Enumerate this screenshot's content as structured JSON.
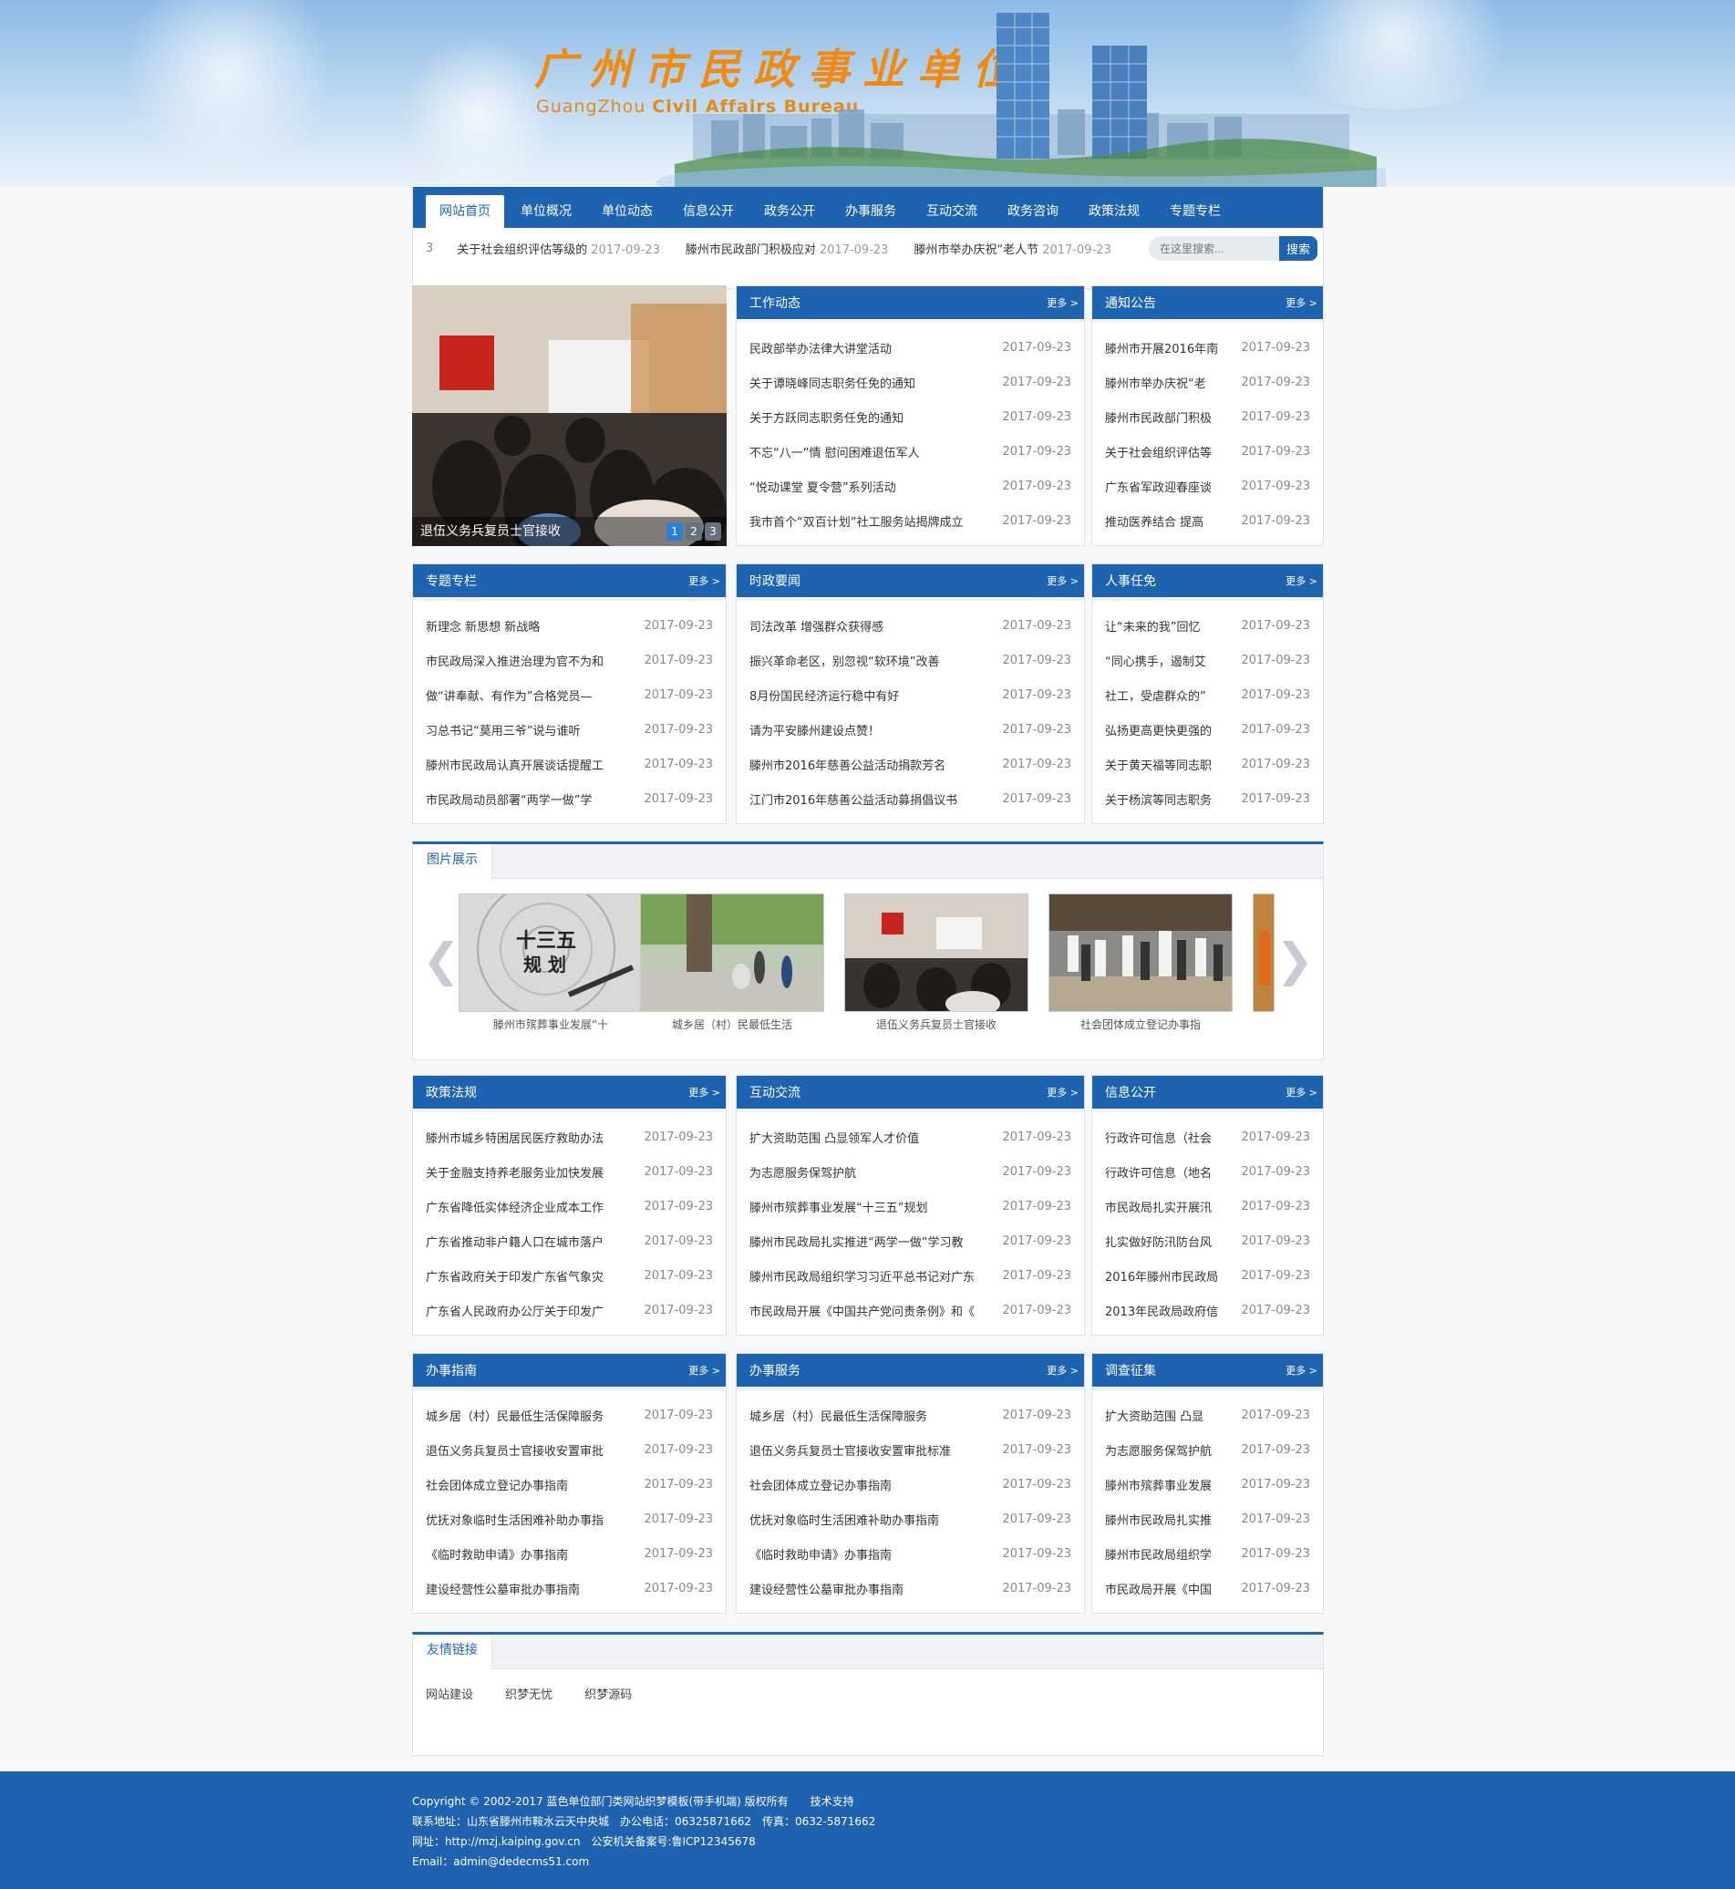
{
  "header": {
    "logo_cn": "广州市民政事业单位",
    "logo_en_light": "GuangZhou ",
    "logo_en_bold": "Civil Affairs Bureau"
  },
  "nav": [
    "网站首页",
    "单位概况",
    "单位动态",
    "信息公开",
    "政务公开",
    "办事服务",
    "互动交流",
    "政务咨询",
    "政策法规",
    "专题专栏"
  ],
  "ticker": {
    "index": "3",
    "items": [
      {
        "title": "关于社会组织评估等级的",
        "date": "2017-09-23"
      },
      {
        "title": "滕州市民政部门积极应对",
        "date": "2017-09-23"
      },
      {
        "title": "滕州市举办庆祝“老人节",
        "date": "2017-09-23"
      }
    ]
  },
  "search": {
    "placeholder": "在这里搜索...",
    "button": "搜索"
  },
  "slider": {
    "caption": "退伍义务兵复员士官接收",
    "dots": [
      "1",
      "2",
      "3"
    ]
  },
  "more": "更多 >",
  "panels": {
    "gzdt": {
      "title": "工作动态",
      "items": [
        [
          "民政部举办法律大讲堂活动",
          "2017-09-23"
        ],
        [
          "关于谭晓峰同志职务任免的通知",
          "2017-09-23"
        ],
        [
          "关于方跃同志职务任免的通知",
          "2017-09-23"
        ],
        [
          "不忘“八一”情 慰问困难退伍军人",
          "2017-09-23"
        ],
        [
          "“悦动课堂 夏令营”系列活动",
          "2017-09-23"
        ],
        [
          "我市首个“双百计划”社工服务站揭牌成立",
          "2017-09-23"
        ]
      ]
    },
    "tzgg": {
      "title": "通知公告",
      "items": [
        [
          "滕州市开展2016年南",
          "2017-09-23"
        ],
        [
          "滕州市举办庆祝“老",
          "2017-09-23"
        ],
        [
          "滕州市民政部门积极",
          "2017-09-23"
        ],
        [
          "关于社会组织评估等",
          "2017-09-23"
        ],
        [
          "广东省军政迎春座谈",
          "2017-09-23"
        ],
        [
          "推动医养结合 提高",
          "2017-09-23"
        ]
      ]
    },
    "ztzl": {
      "title": "专题专栏",
      "items": [
        [
          "新理念 新思想 新战略",
          "2017-09-23"
        ],
        [
          "市民政局深入推进治理为官不为和",
          "2017-09-23"
        ],
        [
          "做“讲奉献、有作为”合格党员—",
          "2017-09-23"
        ],
        [
          "习总书记“莫用三爷”说与谁听",
          "2017-09-23"
        ],
        [
          "滕州市民政局认真开展谈话提醒工",
          "2017-09-23"
        ],
        [
          "市民政局动员部署“两学一做”学",
          "2017-09-23"
        ]
      ]
    },
    "szyw": {
      "title": "时政要闻",
      "items": [
        [
          "司法改革 增强群众获得感",
          "2017-09-23"
        ],
        [
          "振兴革命老区，别忽视“软环境”改善",
          "2017-09-23"
        ],
        [
          "8月份国民经济运行稳中有好",
          "2017-09-23"
        ],
        [
          "请为平安滕州建设点赞！",
          "2017-09-23"
        ],
        [
          "滕州市2016年慈善公益活动捐款芳名",
          "2017-09-23"
        ],
        [
          "江门市2016年慈善公益活动募捐倡议书",
          "2017-09-23"
        ]
      ]
    },
    "rsrm": {
      "title": "人事任免",
      "items": [
        [
          "让“未来的我”回忆",
          "2017-09-23"
        ],
        [
          "“同心携手，遏制艾",
          "2017-09-23"
        ],
        [
          "社工，受虐群众的”",
          "2017-09-23"
        ],
        [
          "弘扬更高更快更强的",
          "2017-09-23"
        ],
        [
          "关于黄天福等同志职",
          "2017-09-23"
        ],
        [
          "关于杨滨等同志职务",
          "2017-09-23"
        ]
      ]
    },
    "zcfg": {
      "title": "政策法规",
      "items": [
        [
          "滕州市城乡特困居民医疗救助办法",
          "2017-09-23"
        ],
        [
          "关于金融支持养老服务业加快发展",
          "2017-09-23"
        ],
        [
          "广东省降低实体经济企业成本工作",
          "2017-09-23"
        ],
        [
          "广东省推动非户籍人口在城市落户",
          "2017-09-23"
        ],
        [
          "广东省政府关于印发广东省气象灾",
          "2017-09-23"
        ],
        [
          "广东省人民政府办公厅关于印发广",
          "2017-09-23"
        ]
      ]
    },
    "hdjl": {
      "title": "互动交流",
      "items": [
        [
          "扩大资助范围 凸显领军人才价值",
          "2017-09-23"
        ],
        [
          "为志愿服务保驾护航",
          "2017-09-23"
        ],
        [
          "滕州市殡葬事业发展“十三五”规划",
          "2017-09-23"
        ],
        [
          "滕州市民政局扎实推进“两学一做”学习教",
          "2017-09-23"
        ],
        [
          "滕州市民政局组织学习习近平总书记对广东",
          "2017-09-23"
        ],
        [
          "市民政局开展《中国共产党问责条例》和《",
          "2017-09-23"
        ]
      ]
    },
    "xxgk": {
      "title": "信息公开",
      "items": [
        [
          "行政许可信息（社会",
          "2017-09-23"
        ],
        [
          "行政许可信息（地名",
          "2017-09-23"
        ],
        [
          "市民政局扎实开展汛",
          "2017-09-23"
        ],
        [
          "扎实做好防汛防台风",
          "2017-09-23"
        ],
        [
          "2016年滕州市民政局",
          "2017-09-23"
        ],
        [
          "2013年民政局政府信",
          "2017-09-23"
        ]
      ]
    },
    "bszn": {
      "title": "办事指南",
      "items": [
        [
          "城乡居（村）民最低生活保障服务",
          "2017-09-23"
        ],
        [
          "退伍义务兵复员士官接收安置审批",
          "2017-09-23"
        ],
        [
          "社会团体成立登记办事指南",
          "2017-09-23"
        ],
        [
          "优抚对象临时生活困难补助办事指",
          "2017-09-23"
        ],
        [
          "《临时救助申请》办事指南",
          "2017-09-23"
        ],
        [
          "建设经营性公墓审批办事指南",
          "2017-09-23"
        ]
      ]
    },
    "bsfw": {
      "title": "办事服务",
      "items": [
        [
          "城乡居（村）民最低生活保障服务",
          "2017-09-23"
        ],
        [
          "退伍义务兵复员士官接收安置审批标准",
          "2017-09-23"
        ],
        [
          "社会团体成立登记办事指南",
          "2017-09-23"
        ],
        [
          "优抚对象临时生活困难补助办事指南",
          "2017-09-23"
        ],
        [
          "《临时救助申请》办事指南",
          "2017-09-23"
        ],
        [
          "建设经营性公墓审批办事指南",
          "2017-09-23"
        ]
      ]
    },
    "dczj": {
      "title": "调查征集",
      "items": [
        [
          "扩大资助范围 凸显",
          "2017-09-23"
        ],
        [
          "为志愿服务保驾护航",
          "2017-09-23"
        ],
        [
          "滕州市殡葬事业发展",
          "2017-09-23"
        ],
        [
          "滕州市民政局扎实推",
          "2017-09-23"
        ],
        [
          "滕州市民政局组织学",
          "2017-09-23"
        ],
        [
          "市民政局开展《中国",
          "2017-09-23"
        ]
      ]
    }
  },
  "gallery": {
    "title": "图片展示",
    "items": [
      "滕州市殡葬事业发展“十",
      "城乡居（村）民最低生活",
      "退伍义务兵复员士官接收",
      "社会团体成立登记办事指"
    ],
    "badge_text": "十三五 规划"
  },
  "links": {
    "title": "友情链接",
    "items": [
      "网站建设",
      "织梦无忧",
      "织梦源码"
    ]
  },
  "footer": {
    "line1": "Copyright © 2002-2017 蓝色单位部门类网站织梦模板(带手机端) 版权所有　　技术支持",
    "line2": "联系地址：山东省滕州市鞍水云天中央城　办公电话：06325871662　传真：0632-5871662",
    "line3": "网址：http://mzj.kaiping.gov.cn　公安机关备案号:鲁ICP12345678",
    "line4": "Email：admin@dedecms51.com"
  },
  "colors": {
    "primary": "#1e63b0",
    "logo_orange": "#f08a12"
  }
}
